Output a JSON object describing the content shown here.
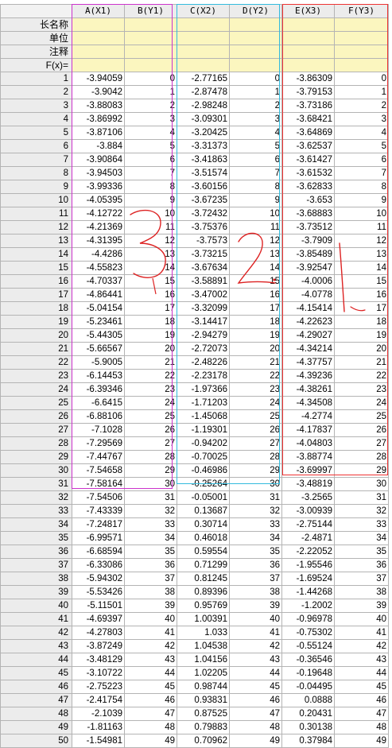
{
  "columns": [
    "A(X1)",
    "B(Y1)",
    "C(X2)",
    "D(Y2)",
    "E(X3)",
    "F(Y3)"
  ],
  "meta_rows": [
    "长名称",
    "单位",
    "注释",
    "F(x)="
  ],
  "rows": [
    [
      "1",
      "-3.94059",
      "0",
      "-2.77165",
      "0",
      "-3.86309",
      "0"
    ],
    [
      "2",
      "-3.9042",
      "1",
      "-2.87478",
      "1",
      "-3.79153",
      "1"
    ],
    [
      "3",
      "-3.88083",
      "2",
      "-2.98248",
      "2",
      "-3.73186",
      "2"
    ],
    [
      "4",
      "-3.86992",
      "3",
      "-3.09301",
      "3",
      "-3.68421",
      "3"
    ],
    [
      "5",
      "-3.87106",
      "4",
      "-3.20425",
      "4",
      "-3.64869",
      "4"
    ],
    [
      "6",
      "-3.884",
      "5",
      "-3.31373",
      "5",
      "-3.62537",
      "5"
    ],
    [
      "7",
      "-3.90864",
      "6",
      "-3.41863",
      "6",
      "-3.61427",
      "6"
    ],
    [
      "8",
      "-3.94503",
      "7",
      "-3.51574",
      "7",
      "-3.61532",
      "7"
    ],
    [
      "9",
      "-3.99336",
      "8",
      "-3.60156",
      "8",
      "-3.62833",
      "8"
    ],
    [
      "10",
      "-4.05395",
      "9",
      "-3.67235",
      "9",
      "-3.653",
      "9"
    ],
    [
      "11",
      "-4.12722",
      "10",
      "-3.72432",
      "10",
      "-3.68883",
      "10"
    ],
    [
      "12",
      "-4.21369",
      "11",
      "-3.75376",
      "11",
      "-3.73512",
      "11"
    ],
    [
      "13",
      "-4.31395",
      "12",
      "-3.7573",
      "12",
      "-3.7909",
      "12"
    ],
    [
      "14",
      "-4.4286",
      "13",
      "-3.73215",
      "13",
      "-3.85489",
      "13"
    ],
    [
      "15",
      "-4.55823",
      "14",
      "-3.67634",
      "14",
      "-3.92547",
      "14"
    ],
    [
      "16",
      "-4.70337",
      "15",
      "-3.58891",
      "15",
      "-4.0006",
      "15"
    ],
    [
      "17",
      "-4.86441",
      "16",
      "-3.47002",
      "16",
      "-4.0778",
      "16"
    ],
    [
      "18",
      "-5.04154",
      "17",
      "-3.32099",
      "17",
      "-4.15414",
      "17"
    ],
    [
      "19",
      "-5.23461",
      "18",
      "-3.14417",
      "18",
      "-4.22623",
      "18"
    ],
    [
      "20",
      "-5.44305",
      "19",
      "-2.94279",
      "19",
      "-4.29027",
      "19"
    ],
    [
      "21",
      "-5.66567",
      "20",
      "-2.72073",
      "20",
      "-4.34214",
      "20"
    ],
    [
      "22",
      "-5.9005",
      "21",
      "-2.48226",
      "21",
      "-4.37757",
      "21"
    ],
    [
      "23",
      "-6.14453",
      "22",
      "-2.23178",
      "22",
      "-4.39236",
      "22"
    ],
    [
      "24",
      "-6.39346",
      "23",
      "-1.97366",
      "23",
      "-4.38261",
      "23"
    ],
    [
      "25",
      "-6.6415",
      "24",
      "-1.71203",
      "24",
      "-4.34508",
      "24"
    ],
    [
      "26",
      "-6.88106",
      "25",
      "-1.45068",
      "25",
      "-4.2774",
      "25"
    ],
    [
      "27",
      "-7.1028",
      "26",
      "-1.19301",
      "26",
      "-4.17837",
      "26"
    ],
    [
      "28",
      "-7.29569",
      "27",
      "-0.94202",
      "27",
      "-4.04803",
      "27"
    ],
    [
      "29",
      "-7.44767",
      "28",
      "-0.70025",
      "28",
      "-3.88774",
      "28"
    ],
    [
      "30",
      "-7.54658",
      "29",
      "-0.46986",
      "29",
      "-3.69997",
      "29"
    ],
    [
      "31",
      "-7.58164",
      "30",
      "-0.25264",
      "30",
      "-3.48819",
      "30"
    ],
    [
      "32",
      "-7.54506",
      "31",
      "-0.05001",
      "31",
      "-3.2565",
      "31"
    ],
    [
      "33",
      "-7.43339",
      "32",
      "0.13687",
      "32",
      "-3.00939",
      "32"
    ],
    [
      "34",
      "-7.24817",
      "33",
      "0.30714",
      "33",
      "-2.75144",
      "33"
    ],
    [
      "35",
      "-6.99571",
      "34",
      "0.46018",
      "34",
      "-2.4871",
      "34"
    ],
    [
      "36",
      "-6.68594",
      "35",
      "0.59554",
      "35",
      "-2.22052",
      "35"
    ],
    [
      "37",
      "-6.33086",
      "36",
      "0.71299",
      "36",
      "-1.95546",
      "36"
    ],
    [
      "38",
      "-5.94302",
      "37",
      "0.81245",
      "37",
      "-1.69524",
      "37"
    ],
    [
      "39",
      "-5.53426",
      "38",
      "0.89396",
      "38",
      "-1.44268",
      "38"
    ],
    [
      "40",
      "-5.11501",
      "39",
      "0.95769",
      "39",
      "-1.2002",
      "39"
    ],
    [
      "41",
      "-4.69397",
      "40",
      "1.00391",
      "40",
      "-0.96978",
      "40"
    ],
    [
      "42",
      "-4.27803",
      "41",
      "1.033",
      "41",
      "-0.75302",
      "41"
    ],
    [
      "43",
      "-3.87249",
      "42",
      "1.04538",
      "42",
      "-0.55124",
      "42"
    ],
    [
      "44",
      "-3.48129",
      "43",
      "1.04156",
      "43",
      "-0.36546",
      "43"
    ],
    [
      "45",
      "-3.10722",
      "44",
      "1.02205",
      "44",
      "-0.19648",
      "44"
    ],
    [
      "46",
      "-2.75223",
      "45",
      "0.98744",
      "45",
      "-0.04495",
      "45"
    ],
    [
      "47",
      "-2.41754",
      "46",
      "0.93831",
      "46",
      "0.0888",
      "46"
    ],
    [
      "48",
      "-2.1039",
      "47",
      "0.87525",
      "47",
      "0.20431",
      "47"
    ],
    [
      "49",
      "-1.81163",
      "48",
      "0.79883",
      "48",
      "0.30138",
      "48"
    ],
    [
      "50",
      "-1.54981",
      "49",
      "0.70962",
      "49",
      "0.37984",
      "49"
    ]
  ],
  "annotations": [
    "3",
    "2",
    "1"
  ],
  "colors": {
    "selection_a": "#cc33cc",
    "selection_b": "#33bbdd",
    "selection_c": "#ee3333",
    "meta_bg": "#fbf6bf",
    "header_bg": "#ececec",
    "grid": "#b4b4b4"
  }
}
